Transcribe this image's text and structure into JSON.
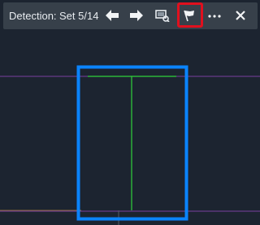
{
  "toolbar": {
    "title": "Detection:",
    "counter": "Set  5/14",
    "buttons": [
      {
        "icon": "arrow-left-icon"
      },
      {
        "icon": "arrow-right-icon"
      },
      {
        "icon": "zoom-to-selection-icon"
      },
      {
        "icon": "flag-icon",
        "highlighted": true
      },
      {
        "icon": "more-icon"
      },
      {
        "icon": "close-icon"
      }
    ]
  },
  "colors": {
    "background": "#1c2430",
    "toolbar": "#37404a",
    "highlight_frame": "#0a84ff",
    "flag_highlight": "#e0101e",
    "detection_lines": "#2fd23a",
    "guide_line": "#7a3fa0"
  }
}
